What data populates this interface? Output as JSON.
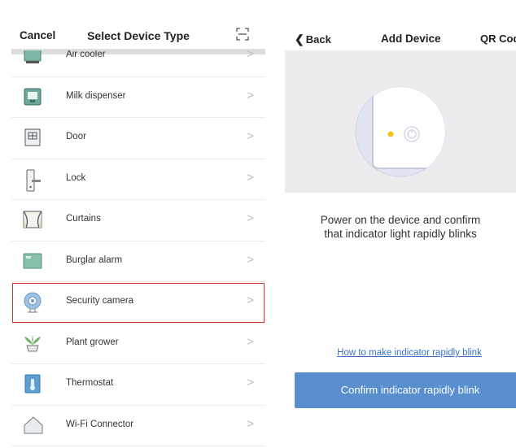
{
  "left": {
    "cancel_label": "Cancel",
    "title": "Select Device Type",
    "scan_icon": "scan-frame-icon",
    "items": [
      {
        "label": "Air cooler",
        "icon": "air-cooler-icon"
      },
      {
        "label": "Milk dispenser",
        "icon": "milk-dispenser-icon"
      },
      {
        "label": "Door",
        "icon": "door-icon"
      },
      {
        "label": "Lock",
        "icon": "lock-icon"
      },
      {
        "label": "Curtains",
        "icon": "curtains-icon"
      },
      {
        "label": "Burglar alarm",
        "icon": "burglar-alarm-icon"
      },
      {
        "label": "Security camera",
        "icon": "security-camera-icon",
        "selected": true
      },
      {
        "label": "Plant grower",
        "icon": "plant-grower-icon"
      },
      {
        "label": "Thermostat",
        "icon": "thermostat-icon"
      },
      {
        "label": "Wi-Fi Connector",
        "icon": "wifi-connector-icon"
      }
    ],
    "chevron": ">"
  },
  "right": {
    "back_label": "Back",
    "title": "Add Device",
    "qr_label": "QR Cod",
    "instruction_line1": "Power on the device and confirm",
    "instruction_line2": "that indicator light rapidly blinks",
    "help_link": "How to make indicator rapidly blink",
    "confirm_button": "Confirm indicator rapidly blink"
  },
  "colors": {
    "accent_button": "#5a8fcf",
    "link": "#3a73c9",
    "selection_outline": "#d93030",
    "indicator_light": "#f0c419"
  }
}
